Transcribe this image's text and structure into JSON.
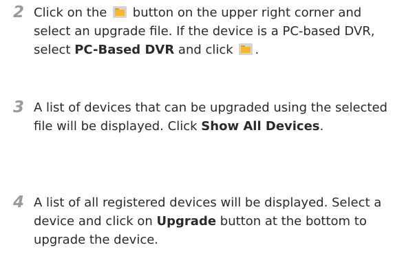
{
  "steps": [
    {
      "number": "2",
      "text_1": "Click on the",
      "text_2": "button on the upper right corner and select an upgrade file. If the device is a PC-based DVR, select",
      "bold_1": "PC-Based DVR",
      "text_3": "and click",
      "text_4": ".",
      "icon": "folder-icon"
    },
    {
      "number": "3",
      "text_1": "A list of devices that can be upgraded using the selected file will be displayed. Click",
      "bold_1": "Show All Devices",
      "text_2": "."
    },
    {
      "number": "4",
      "text_1": "A list of all registered devices will be displayed. Select a device and click on",
      "bold_1": "Upgrade",
      "text_2": "button at the bottom to upgrade the device."
    }
  ],
  "colors": {
    "step_number": "#9a9a9a",
    "text": "#2a2a2a",
    "folder_icon_bg": "#d4d4d4",
    "folder_icon_fill": "#f3b732"
  }
}
